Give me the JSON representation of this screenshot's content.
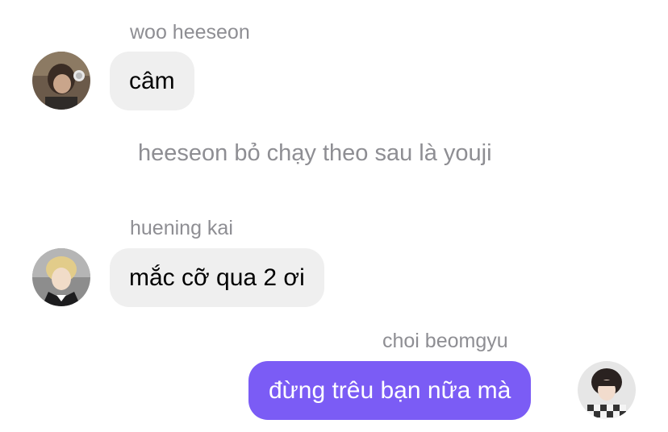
{
  "messages": [
    {
      "sender": "woo heeseon",
      "text": "câm",
      "avatar_icon": "user-avatar-woo-heeseon",
      "direction": "incoming"
    },
    {
      "system": "heeseon bỏ chạy theo sau là youji"
    },
    {
      "sender": "huening kai",
      "text": "mắc cỡ qua 2 ơi",
      "avatar_icon": "user-avatar-huening-kai",
      "direction": "incoming"
    },
    {
      "sender": "choi beomgyu",
      "text": "đừng trêu bạn nữa mà",
      "avatar_icon": "user-avatar-choi-beomgyu",
      "direction": "outgoing"
    }
  ],
  "colors": {
    "incoming_bubble": "#efefef",
    "outgoing_bubble": "#7b5cf5",
    "name_text": "#8e8e93"
  }
}
